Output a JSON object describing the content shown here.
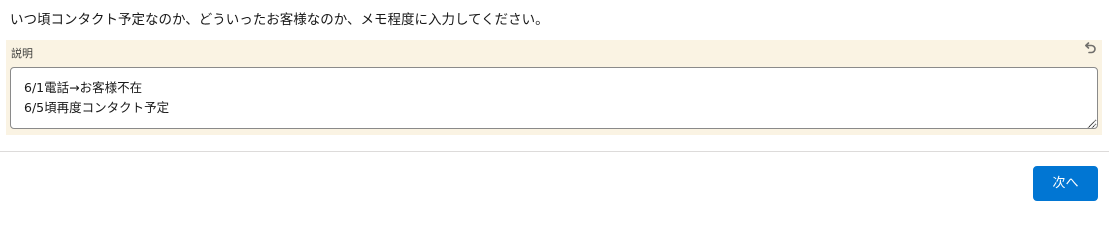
{
  "instruction": "いつ頃コンタクト予定なのか、どういったお客様なのか、メモ程度に入力してください。",
  "field": {
    "label": "説明",
    "undo_icon": "undo-icon",
    "value_lines": [
      "6/1電話→お客様不在",
      "6/5頃再度コンタクト予定"
    ]
  },
  "footer": {
    "next_label": "次へ"
  },
  "colors": {
    "panel_bg": "#faf3e3",
    "brand_button": "#0176d3"
  }
}
